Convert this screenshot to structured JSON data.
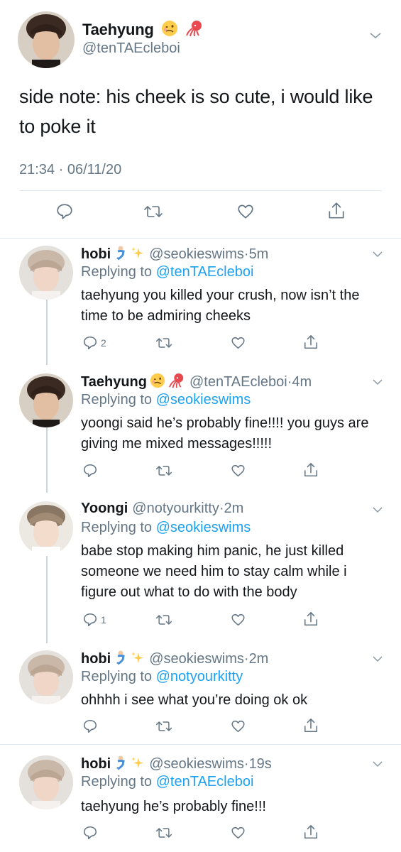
{
  "main_tweet": {
    "name": "Taehyung",
    "name_emojis": [
      "woozy-face-emoji",
      "squid-emoji"
    ],
    "handle": "@tenTAEcleboi",
    "text": "side note: his cheek is so cute, i would like to poke it",
    "timestamp": "21:34 · 06/11/20",
    "actions": [
      "reply-icon",
      "retweet-icon",
      "like-icon",
      "share-icon"
    ]
  },
  "replies": [
    {
      "name": "hobi",
      "name_emojis": [
        "merperson-emoji",
        "sparkles-emoji"
      ],
      "handle": "@seokieswims",
      "dot": "·",
      "ago": "5m",
      "replying_label": "Replying to",
      "replying_to": "@tenTAEcleboi",
      "text": "taehyung you killed your crush, now isn’t the time to be admiring cheeks",
      "reply_count": "2"
    },
    {
      "name": "Taehyung",
      "name_emojis": [
        "woozy-face-emoji",
        "squid-emoji"
      ],
      "handle": "@tenTAEcleboi",
      "dot": "·",
      "ago": "4m",
      "replying_label": "Replying to",
      "replying_to": "@seokieswims",
      "text": "yoongi said he’s probably fine!!!! you guys are giving me mixed messages!!!!!",
      "reply_count": ""
    },
    {
      "name": "Yoongi",
      "name_emojis": [],
      "handle": "@notyourkitty",
      "dot": "·",
      "ago": "2m",
      "replying_label": "Replying to",
      "replying_to": "@seokieswims",
      "text": "babe stop making him panic, he just killed someone we need him to stay calm while i figure out what to do with the body",
      "reply_count": "1"
    },
    {
      "name": "hobi",
      "name_emojis": [
        "merperson-emoji",
        "sparkles-emoji"
      ],
      "handle": "@seokieswims",
      "dot": "·",
      "ago": "2m",
      "replying_label": "Replying to",
      "replying_to": "@notyourkitty",
      "text": "ohhhh i see what you’re doing ok ok",
      "reply_count": ""
    },
    {
      "name": "hobi",
      "name_emojis": [
        "merperson-emoji",
        "sparkles-emoji"
      ],
      "handle": "@seokieswims",
      "dot": "·",
      "ago": "19s",
      "replying_label": "Replying to",
      "replying_to": "@tenTAEcleboi",
      "text": "taehyung he’s probably fine!!!",
      "reply_count": ""
    }
  ],
  "colors": {
    "text": "#14171a",
    "secondary": "#657786",
    "accent": "#1da1f2",
    "divider": "#e1e8ed"
  }
}
